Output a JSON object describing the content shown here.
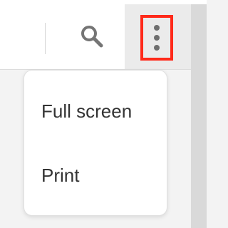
{
  "toolbar": {
    "search_icon": "search-icon",
    "more_icon": "vertical-ellipsis-icon",
    "highlight_color": "#ff2a1a"
  },
  "menu": {
    "items": [
      {
        "label": "Full screen"
      },
      {
        "label": "Print"
      }
    ]
  }
}
